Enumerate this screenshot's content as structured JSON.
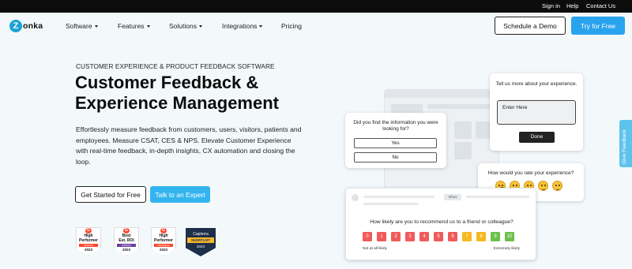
{
  "topbar": {
    "sign_in": "Sign in",
    "help": "Help",
    "contact": "Contact Us"
  },
  "nav": {
    "logo_mark": "Z",
    "logo_text": "onka",
    "items": [
      "Software",
      "Features",
      "Solutions",
      "Integrations",
      "Pricing"
    ],
    "demo_label": "Schedule a Demo",
    "try_label": "Try for Free"
  },
  "hero": {
    "eyebrow": "CUSTOMER EXPERIENCE & PRODUCT FEEDBACK SOFTWARE",
    "title_line1": "Customer Feedback &",
    "title_line2": "Experience Management",
    "description": "Effortlessly measure feedback from customers, users, visitors, patients and employees. Measure CSAT, CES & NPS. Elevate Customer Experience with real-time feedback, in-depth insights, CX automation and closing the loop.",
    "start_label": "Get Started for Free",
    "expert_label": "Talk to an Expert"
  },
  "badges": [
    {
      "line1": "High",
      "line2": "Performer",
      "strip": "SPRING",
      "year": "2023",
      "color": "#ff492c"
    },
    {
      "line1": "Best",
      "line2": "Est. ROI",
      "strip": "SPRING",
      "year": "2023",
      "color": "#6b3fa0"
    },
    {
      "line1": "High",
      "line2": "Performer",
      "strip": "Mid-Market",
      "year": "2023",
      "color": "#ff492c"
    }
  ],
  "capterra": {
    "brand": "Capterra",
    "label": "SHORTLIST",
    "year": "2023"
  },
  "survey_info": {
    "question": "Did you find the information you were looking for?",
    "yes": "Yes",
    "no": "No"
  },
  "survey_text": {
    "question": "Tell us more about your experience.",
    "placeholder": "Enter Here",
    "done": "Done"
  },
  "survey_rate": {
    "question": "How would you rate your experience?",
    "faces": [
      "very-unhappy-face-icon",
      "unhappy-face-icon",
      "neutral-face-icon",
      "happy-face-icon",
      "very-happy-face-icon"
    ]
  },
  "survey_nps": {
    "inbox": "Inbox",
    "question": "How likely are you to recommend us to a friend or colleague?",
    "scale": [
      "0",
      "1",
      "2",
      "3",
      "4",
      "5",
      "6",
      "7",
      "8",
      "9",
      "10"
    ],
    "colors": [
      "#f05a5a",
      "#f05a5a",
      "#f05a5a",
      "#f05a5a",
      "#f05a5a",
      "#f05a5a",
      "#f05a5a",
      "#f5b81f",
      "#f5b81f",
      "#6cc04a",
      "#6cc04a"
    ],
    "low_label": "Not at all likely",
    "high_label": "Extremely likely"
  },
  "feedback_tab": "Give Feedback",
  "colors": {
    "brand": "#1ba3d6",
    "accent": "#2aa3ee",
    "background": "#f3f9fb"
  }
}
